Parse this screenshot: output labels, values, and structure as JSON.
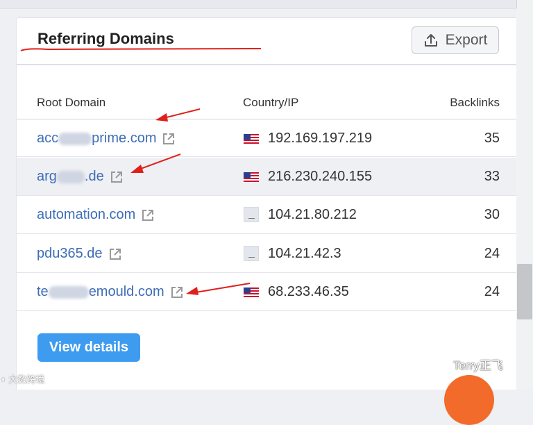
{
  "panel": {
    "title": "Referring Domains",
    "export_label": "Export",
    "view_details_label": "View details"
  },
  "table": {
    "columns": [
      "Root Domain",
      "Country/IP",
      "Backlinks"
    ],
    "rows": [
      {
        "domain_start": "acc",
        "domain_end": "prime.com",
        "country": "US",
        "ip": "192.169.197.219",
        "backlinks": "35"
      },
      {
        "domain_start": "arg",
        "domain_end": ".de",
        "country": "US",
        "ip": "216.230.240.155",
        "backlinks": "33"
      },
      {
        "domain_start": "automation.com",
        "domain_end": "",
        "country": "unknown",
        "ip": "104.21.80.212",
        "backlinks": "30"
      },
      {
        "domain_start": "pdu365.de",
        "domain_end": "",
        "country": "unknown",
        "ip": "104.21.42.3",
        "backlinks": "24"
      },
      {
        "domain_start": "te",
        "domain_end": "emould.com",
        "country": "US",
        "ip": "68.233.46.35",
        "backlinks": "24"
      }
    ]
  },
  "watermark": {
    "right": "Terry正飞",
    "left": "大数跨境"
  },
  "colors": {
    "link": "#3d6db5",
    "primary_button": "#3d9cf0",
    "annotation_red": "#e0201b"
  },
  "icons": [
    "upload-icon",
    "external-link-icon",
    "us-flag-icon",
    "unknown-flag-icon",
    "wechat-icon"
  ]
}
